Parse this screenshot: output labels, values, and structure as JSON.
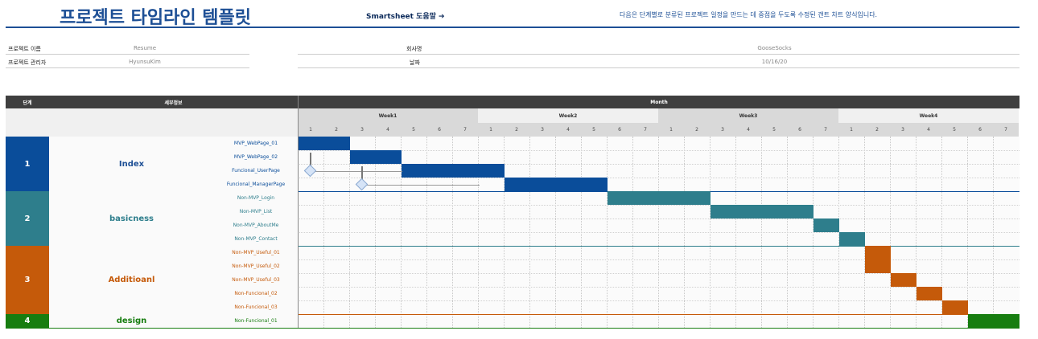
{
  "header": {
    "title": "프로젝트 타임라인 템플릿",
    "help_link": "Smartsheet 도움말 ➔",
    "description": "다음은 단계별로 분류된 프로젝트 일정을 만드는 데 중점을 두도록 수정된 갠트 차트 양식입니다."
  },
  "info": {
    "project_name_label": "프로젝트 이름",
    "project_name_value": "Resume",
    "manager_label": "프로젝트 관리자",
    "manager_value": "HyunsuKim",
    "company_label": "회사명",
    "company_value": "GooseSocks",
    "date_label": "날짜",
    "date_value": "10/16/20"
  },
  "grid_header": {
    "phase_col": "단계",
    "detail_col": "세부정보",
    "month_label": "Month",
    "weeks": [
      "Week1",
      "Week2",
      "Week3",
      "Week4"
    ],
    "days": [
      "1",
      "2",
      "3",
      "4",
      "5",
      "6",
      "7"
    ]
  },
  "colors": {
    "blue": "#0a4d9a",
    "teal": "#2e7e8c",
    "orange": "#c55a0a",
    "green": "#177d10",
    "week_shade": "#d9d9d9",
    "week_light": "#f0f0f0"
  },
  "phases": [
    {
      "num": "1",
      "name": "Index",
      "color": "#0a4d9a",
      "name_color": "#1d4f95",
      "tasks": [
        {
          "label": "MVP_WebPage_01",
          "start": 1,
          "length": 2
        },
        {
          "label": "MVP_WebPage_02",
          "start": 3,
          "length": 2
        },
        {
          "label": "Funcional_UserPage",
          "start": 5,
          "length": 4
        },
        {
          "label": "Funcional_ManagerPage",
          "start": 9,
          "length": 4
        }
      ]
    },
    {
      "num": "2",
      "name": "basicness",
      "color": "#2e7e8c",
      "name_color": "#2e7e8c",
      "tasks": [
        {
          "label": "Non-MVP_Login",
          "start": 13,
          "length": 4
        },
        {
          "label": "Non-MVP_List",
          "start": 17,
          "length": 4
        },
        {
          "label": "Non-MVP_AboutMe",
          "start": 21,
          "length": 1
        },
        {
          "label": "Non-MVP_Contact",
          "start": 22,
          "length": 1
        }
      ]
    },
    {
      "num": "3",
      "name": "Additioanl",
      "color": "#c55a0a",
      "name_color": "#c55a0a",
      "tasks": [
        {
          "label": "Non-MVP_Useful_01",
          "start": 23,
          "length": 1
        },
        {
          "label": "Non-MVP_Useful_02",
          "start": 23,
          "length": 1
        },
        {
          "label": "Non-MVP_Useful_03",
          "start": 24,
          "length": 1
        },
        {
          "label": "Non-Funcional_02",
          "start": 25,
          "length": 1
        },
        {
          "label": "Non-Funcional_03",
          "start": 26,
          "length": 1
        }
      ]
    },
    {
      "num": "4",
      "name": "design",
      "color": "#177d10",
      "name_color": "#177d10",
      "tasks": [
        {
          "label": "Non-Funcional_01",
          "start": 27,
          "length": 2
        }
      ]
    }
  ],
  "milestones": [
    {
      "task_row": 2,
      "day": 1
    },
    {
      "task_row": 3,
      "day": 3
    }
  ]
}
